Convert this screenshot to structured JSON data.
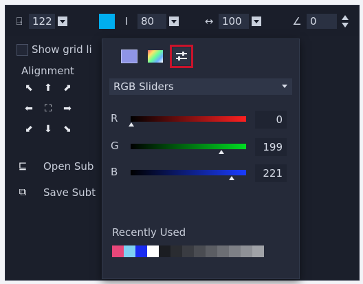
{
  "toolbar": {
    "width_value": "122",
    "height_value": "80",
    "spacing_value": "100",
    "angle_value": "0",
    "fill_color": "#00aeef"
  },
  "left_panel": {
    "show_grid_label": "Show grid li",
    "alignment_label": "Alignment",
    "open_sub_label": "Open Sub",
    "save_sub_label": "Save Subt"
  },
  "color_popup": {
    "mode": "RGB Sliders",
    "r_label": "R",
    "g_label": "G",
    "b_label": "B",
    "r_value": "0",
    "g_value": "199",
    "b_value": "221",
    "recent_label": "Recently Used",
    "recent_colors": [
      "#e8477a",
      "#7fd0f2",
      "#1a2cf0",
      "#ffffff",
      "#1b1d22",
      "#2a2c31",
      "#3a3c42",
      "#4a4c52",
      "#5b5d63",
      "#6c6e74",
      "#7e8086",
      "#8f9197",
      "#a1a3a8"
    ]
  },
  "colors": {
    "app_bg": "#1b1f2b",
    "popup_bg": "#252a39",
    "active_outline": "#c9132b"
  }
}
